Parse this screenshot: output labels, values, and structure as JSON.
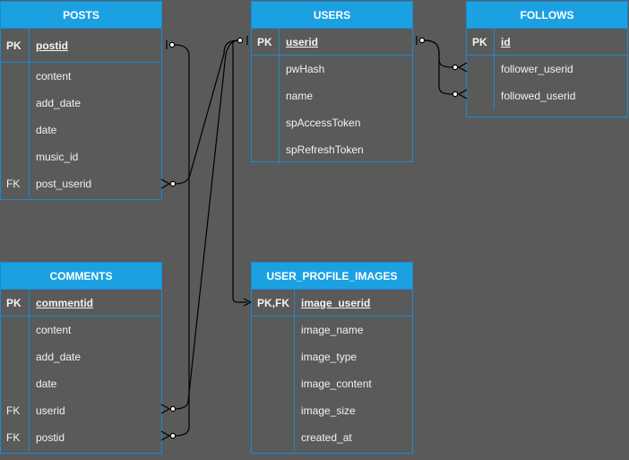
{
  "tables": {
    "posts": {
      "title": "POSTS",
      "rows": [
        {
          "key": "PK",
          "field": "postid"
        },
        {
          "key": "",
          "field": "content"
        },
        {
          "key": "",
          "field": "add_date"
        },
        {
          "key": "",
          "field": "date"
        },
        {
          "key": "",
          "field": "music_id"
        },
        {
          "key": "FK",
          "field": "post_userid"
        }
      ]
    },
    "users": {
      "title": "USERS",
      "rows": [
        {
          "key": "PK",
          "field": "userid"
        },
        {
          "key": "",
          "field": "pwHash"
        },
        {
          "key": "",
          "field": "name"
        },
        {
          "key": "",
          "field": "spAccessToken"
        },
        {
          "key": "",
          "field": "spRefreshToken"
        }
      ]
    },
    "follows": {
      "title": "FOLLOWS",
      "rows": [
        {
          "key": "PK",
          "field": "id"
        },
        {
          "key": "",
          "field": "follower_userid"
        },
        {
          "key": "",
          "field": "followed_userid"
        }
      ]
    },
    "comments": {
      "title": "COMMENTS",
      "rows": [
        {
          "key": "PK",
          "field": "commentid"
        },
        {
          "key": "",
          "field": "content"
        },
        {
          "key": "",
          "field": "add_date"
        },
        {
          "key": "",
          "field": "date"
        },
        {
          "key": "FK",
          "field": "userid"
        },
        {
          "key": "FK",
          "field": "postid"
        }
      ]
    },
    "user_profile_images": {
      "title": "USER_PROFILE_IMAGES",
      "rows": [
        {
          "key": "PK,FK",
          "field": "image_userid"
        },
        {
          "key": "",
          "field": "image_name"
        },
        {
          "key": "",
          "field": "image_type"
        },
        {
          "key": "",
          "field": "image_content"
        },
        {
          "key": "",
          "field": "image_size"
        },
        {
          "key": "",
          "field": "created_at"
        }
      ]
    }
  },
  "colors": {
    "header": "#1ba1e2",
    "border": "#1a8ad4",
    "background": "#5a5a5a",
    "connector": "#000000"
  }
}
